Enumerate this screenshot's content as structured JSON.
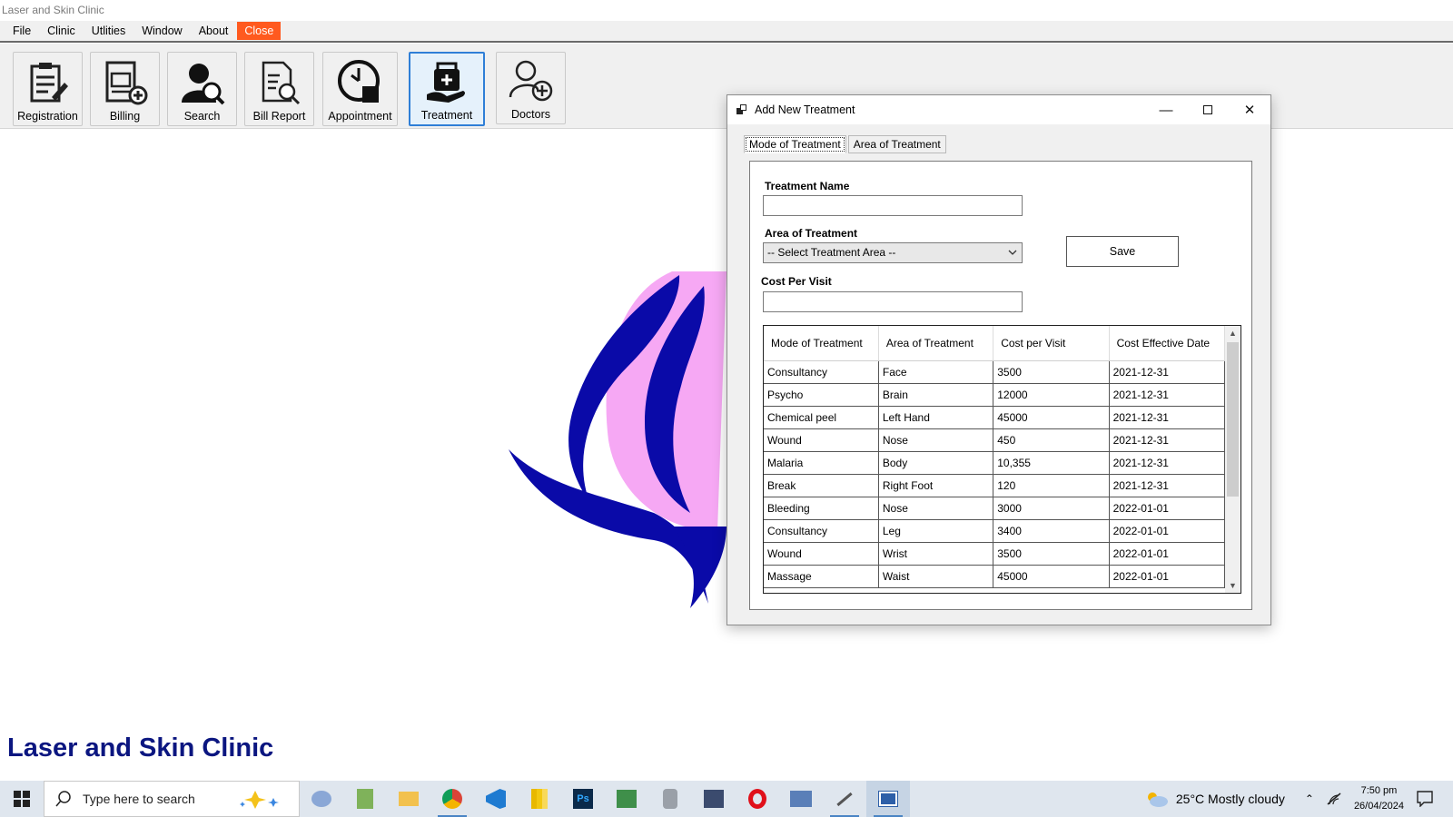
{
  "app": {
    "title": "Laser and Skin Clinic",
    "footer_name": "Laser and Skin Clinic"
  },
  "menu": {
    "items": [
      "File",
      "Clinic",
      "Utlities",
      "Window",
      "About"
    ],
    "close_label": "Close"
  },
  "toolbar": {
    "buttons": [
      {
        "label": "Registration",
        "icon": "registration-icon"
      },
      {
        "label": "Billing",
        "icon": "billing-icon"
      },
      {
        "label": "Search",
        "icon": "search-user-icon"
      },
      {
        "label": "Bill Report",
        "icon": "bill-report-icon"
      },
      {
        "label": "Appointment",
        "icon": "appointment-clock-icon"
      },
      {
        "label": "Treatment",
        "icon": "treatment-kit-icon",
        "active": true
      },
      {
        "label": "Doctors",
        "icon": "add-doctor-icon"
      }
    ]
  },
  "dialog": {
    "title": "Add New Treatment",
    "tabs": [
      "Mode of Treatment",
      "Area of Treatment"
    ],
    "treatment_name_label": "Treatment Name",
    "treatment_name_value": "",
    "area_label": "Area of Treatment",
    "area_selected": "-- Select Treatment Area  --",
    "cost_label": "Cost Per Visit",
    "cost_value": "",
    "save_label": "Save",
    "grid": {
      "columns": [
        "Mode of Treatment",
        "Area of Treatment",
        "Cost per Visit",
        "Cost Effective Date"
      ],
      "rows": [
        [
          "Consultancy",
          "Face",
          "3500",
          "2021-12-31"
        ],
        [
          "Psycho",
          "Brain",
          "12000",
          "2021-12-31"
        ],
        [
          "Chemical peel",
          "Left Hand",
          "45000",
          "2021-12-31"
        ],
        [
          "Wound",
          "Nose",
          "450",
          "2021-12-31"
        ],
        [
          "Malaria",
          "Body",
          "10,355",
          "2021-12-31"
        ],
        [
          "Break",
          "Right Foot",
          "120",
          "2021-12-31"
        ],
        [
          "Bleeding",
          "Nose",
          "3000",
          "2022-01-01"
        ],
        [
          "Consultancy",
          "Leg",
          "3400",
          "2022-01-01"
        ],
        [
          "Wound",
          "Wrist",
          "3500",
          "2022-01-01"
        ],
        [
          "Massage",
          "Waist",
          "45000",
          "2022-01-01"
        ]
      ]
    }
  },
  "taskbar": {
    "search_placeholder": "Type here to search",
    "weather": "25°C  Mostly cloudy",
    "time": "7:50 pm",
    "date": "26/04/2024"
  },
  "colors": {
    "close_menu": "#ff5a1f",
    "brand_text": "#0b1680",
    "logo_pink": "#f6a8f4",
    "logo_blue": "#0a0aa8",
    "active_button_border": "#2f7fd7"
  }
}
